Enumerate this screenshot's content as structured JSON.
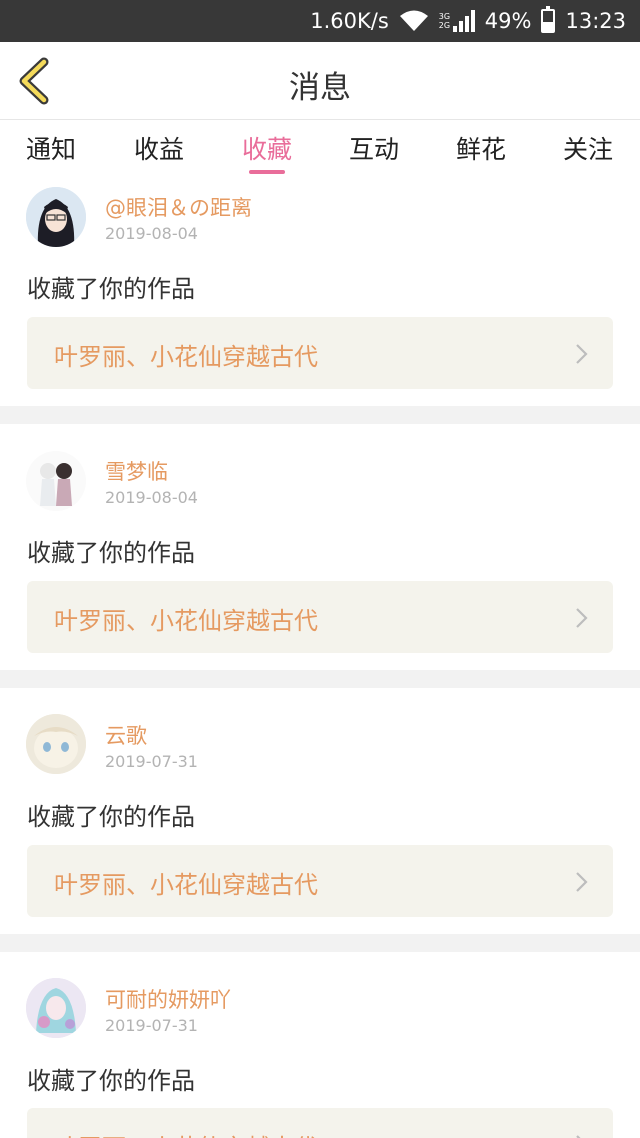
{
  "status_bar": {
    "speed": "1.60K/s",
    "network": "3G 2G",
    "battery": "49%",
    "time": "13:23"
  },
  "header": {
    "title": "消息"
  },
  "tabs": [
    {
      "label": "通知"
    },
    {
      "label": "收益"
    },
    {
      "label": "收藏",
      "active": true
    },
    {
      "label": "互动"
    },
    {
      "label": "鲜花"
    },
    {
      "label": "关注"
    }
  ],
  "messages": [
    {
      "username": "@眼泪＆の距离",
      "date": "2019-08-04",
      "action": "收藏了你的作品",
      "work": "叶罗丽、小花仙穿越古代"
    },
    {
      "username": "雪梦临",
      "date": "2019-08-04",
      "action": "收藏了你的作品",
      "work": "叶罗丽、小花仙穿越古代"
    },
    {
      "username": "云歌",
      "date": "2019-07-31",
      "action": "收藏了你的作品",
      "work": "叶罗丽、小花仙穿越古代"
    },
    {
      "username": "可耐的妍妍吖",
      "date": "2019-07-31",
      "action": "收藏了你的作品",
      "work": "叶罗丽、小花仙穿越古代"
    }
  ],
  "colors": {
    "accent": "#e96d9a",
    "username": "#e59a61",
    "status_bar": "#383838",
    "link_bg": "#f4f3ec"
  }
}
